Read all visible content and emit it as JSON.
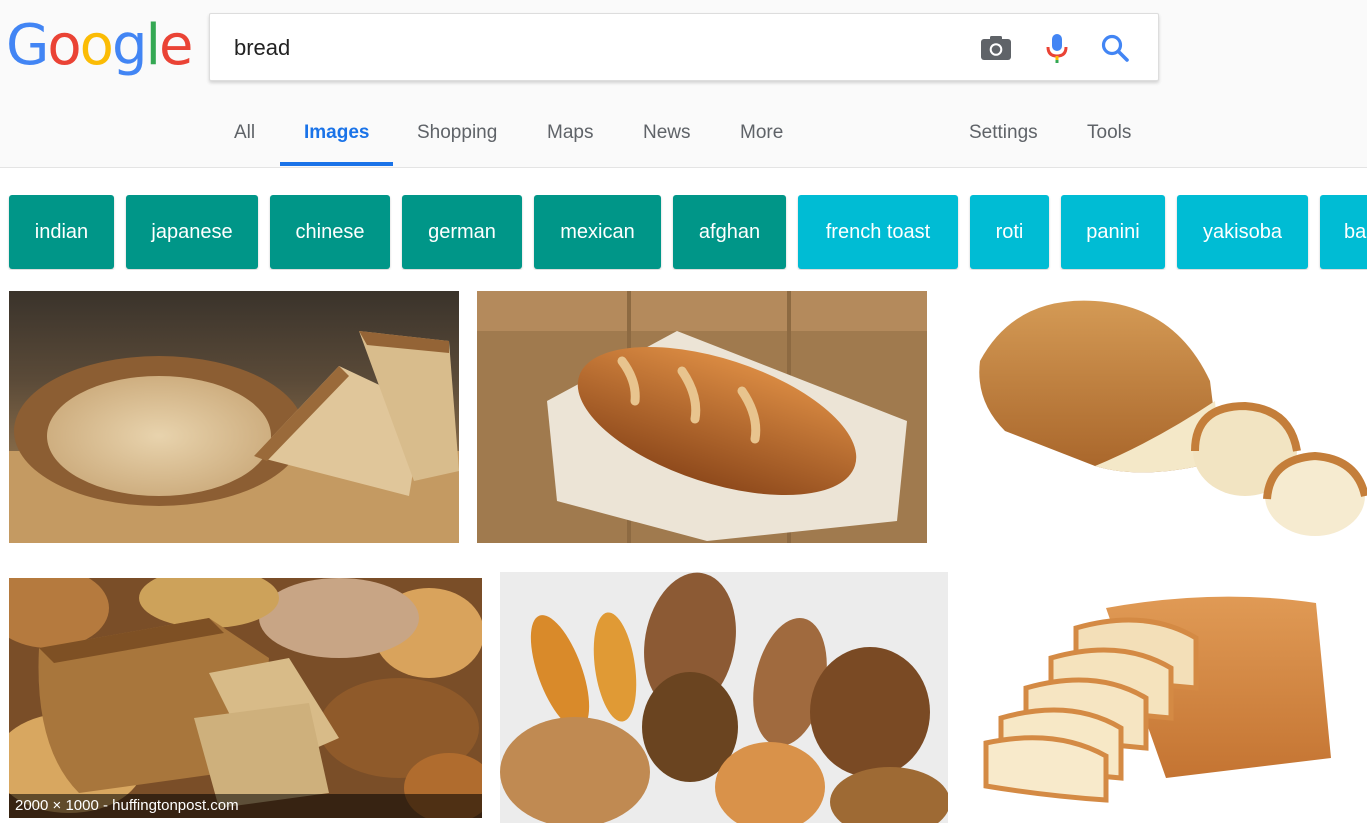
{
  "logo": {
    "letters": [
      "G",
      "o",
      "o",
      "g",
      "l",
      "e"
    ]
  },
  "colors": {
    "blue": "#4285F4",
    "red": "#EA4335",
    "yellow": "#FBBC05",
    "green": "#34A853",
    "chip_dark": "#009688",
    "chip_light": "#00bcd4",
    "tab_active": "#1a73e8"
  },
  "search": {
    "value": "bread",
    "camera_icon": "camera-icon",
    "mic_icon": "microphone-icon",
    "search_icon": "search-icon"
  },
  "nav": {
    "tabs": [
      {
        "label": "All"
      },
      {
        "label": "Images",
        "active": true
      },
      {
        "label": "Shopping"
      },
      {
        "label": "Maps"
      },
      {
        "label": "News"
      },
      {
        "label": "More"
      }
    ],
    "settings": "Settings",
    "tools": "Tools"
  },
  "chips": [
    {
      "label": "indian"
    },
    {
      "label": "japanese"
    },
    {
      "label": "chinese"
    },
    {
      "label": "german"
    },
    {
      "label": "mexican"
    },
    {
      "label": "afghan"
    },
    {
      "label": "french toast"
    },
    {
      "label": "roti"
    },
    {
      "label": "panini"
    },
    {
      "label": "yakisoba"
    },
    {
      "label": "ba"
    }
  ],
  "results": {
    "hover_caption": "2000 × 1000 - huffingtonpost.com"
  }
}
